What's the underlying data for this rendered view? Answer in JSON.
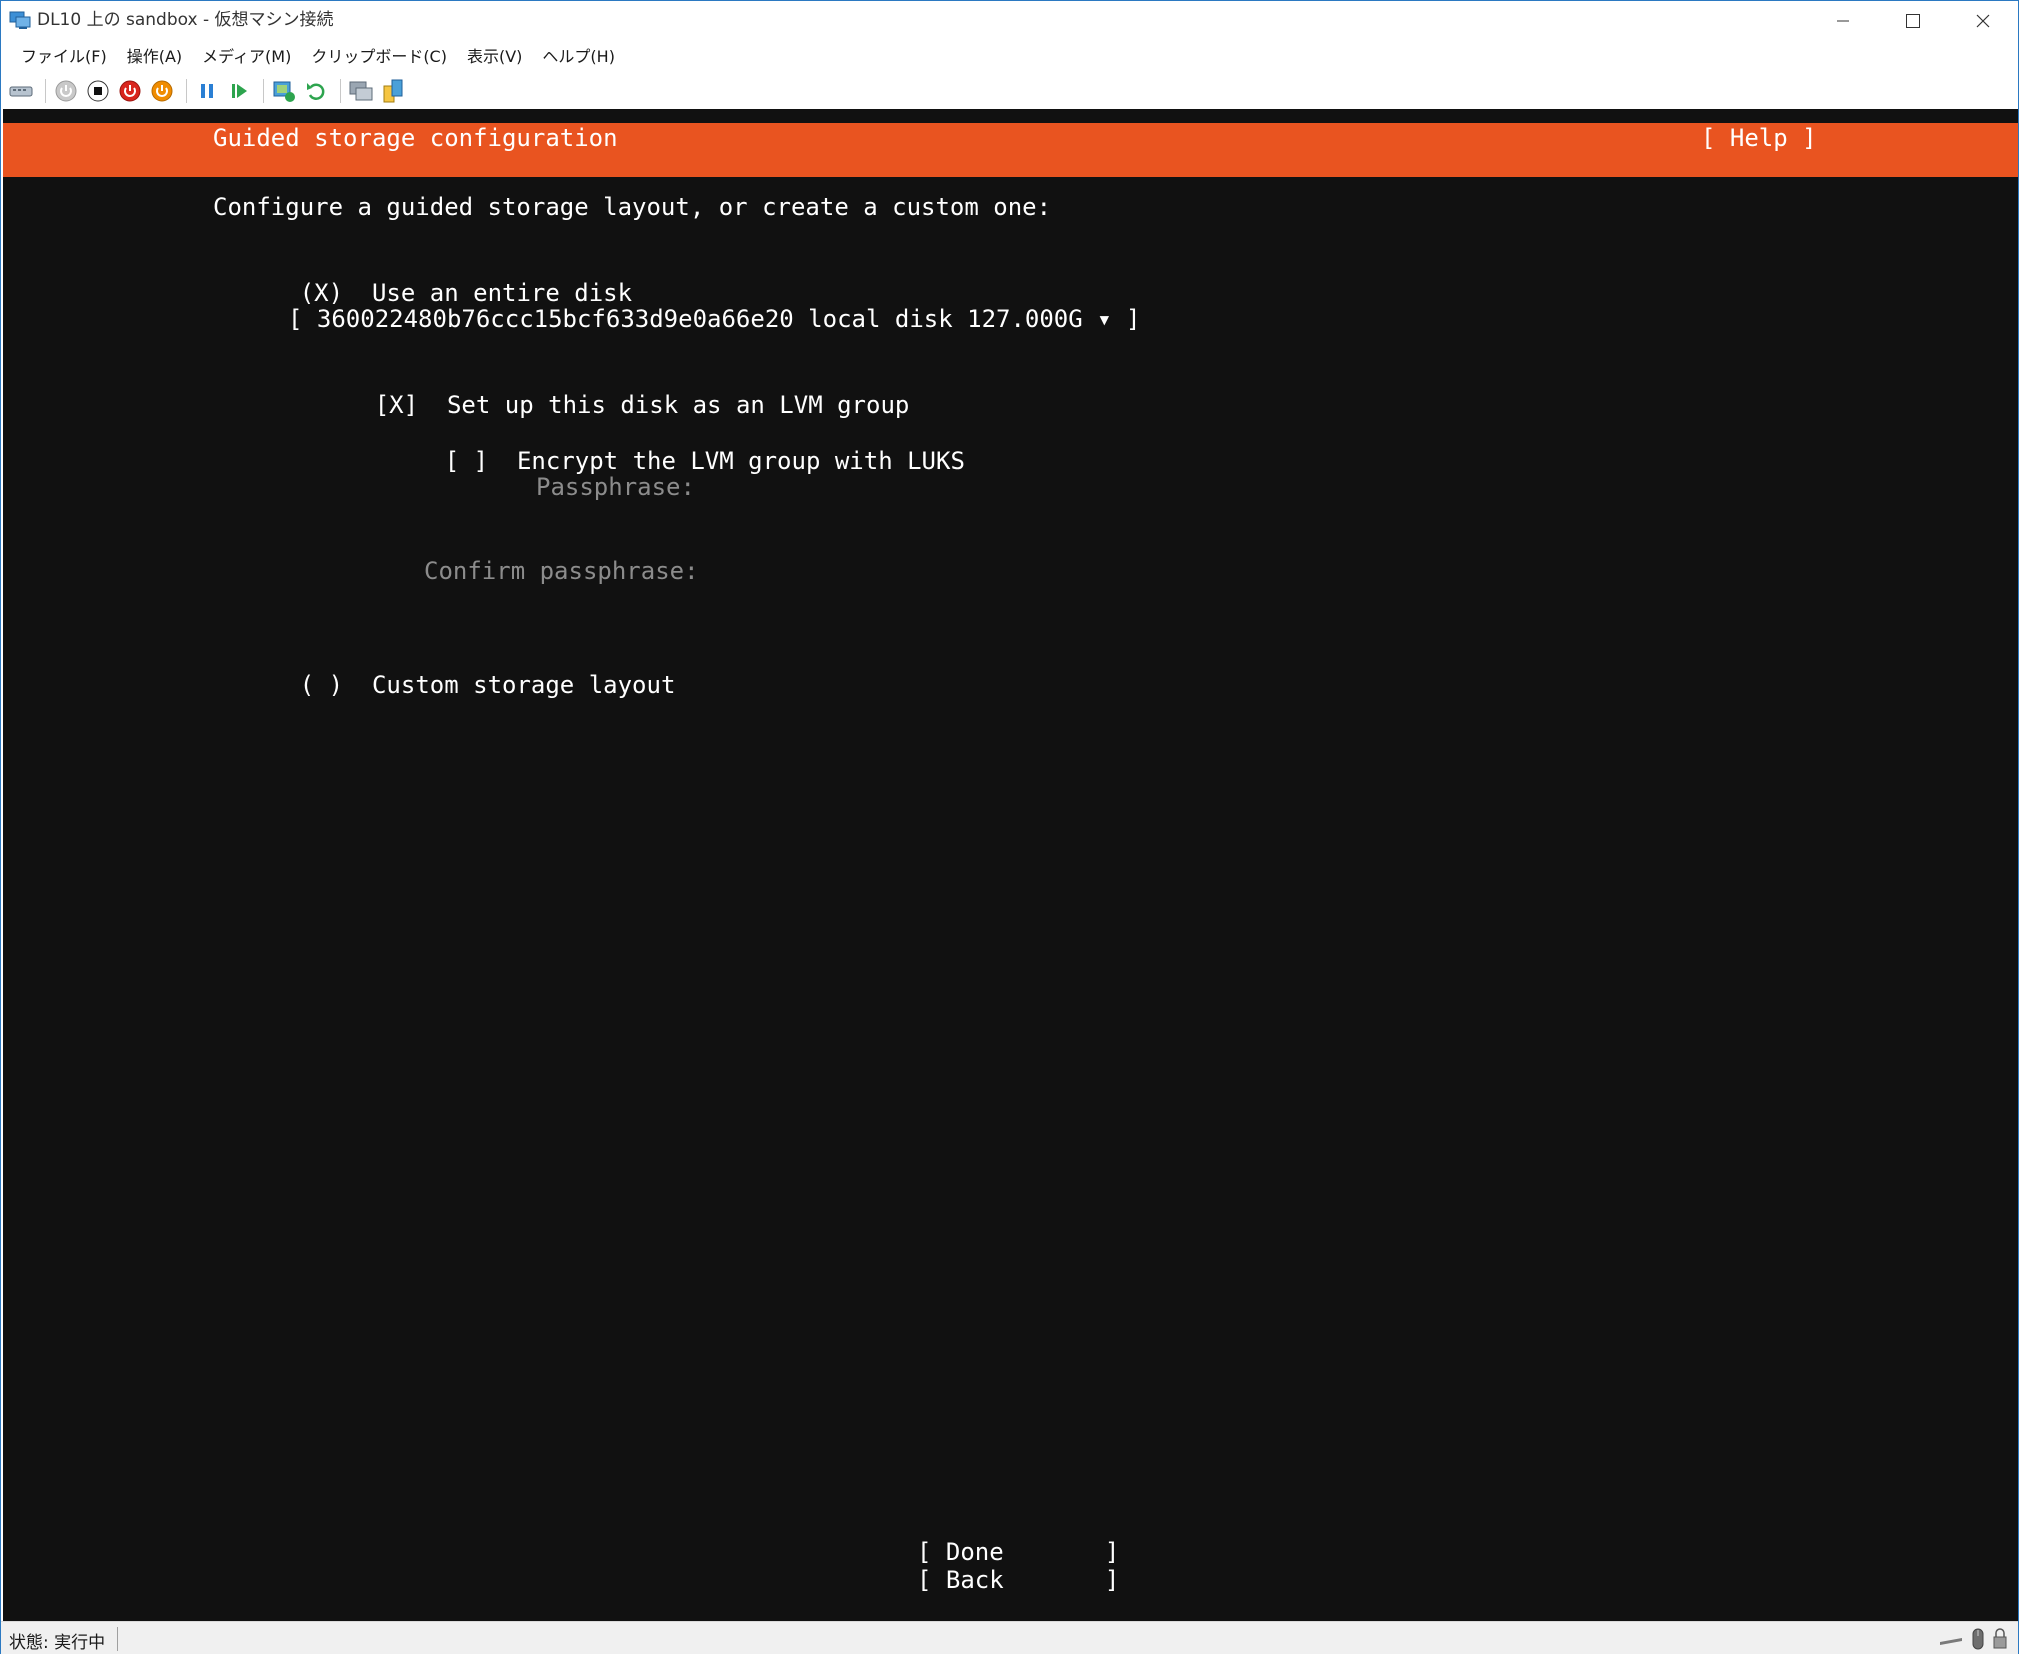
{
  "window": {
    "title": "DL10 上の sandbox - 仮想マシン接続",
    "minimize_icon": "minimize-icon",
    "maximize_icon": "maximize-icon",
    "close_icon": "close-icon"
  },
  "menu": {
    "items": [
      "ファイル(F)",
      "操作(A)",
      "メディア(M)",
      "クリップボード(C)",
      "表示(V)",
      "ヘルプ(H)"
    ]
  },
  "toolbar": {
    "icons": [
      "ctrl-alt-del-icon",
      "start-icon",
      "turn-off-icon",
      "shut-down-icon",
      "save-icon",
      "pause-icon",
      "resume-icon",
      "checkpoint-icon",
      "revert-icon",
      "enhanced-session-icon",
      "share-icon"
    ]
  },
  "installer": {
    "header_title": "Guided storage configuration",
    "help_label": "[ Help ]",
    "prompt": "Configure a guided storage layout, or create a custom one:",
    "use_entire_disk": {
      "marker": "(X)",
      "label": "Use an entire disk"
    },
    "disk_select": "[ 360022480b76ccc15bcf633d9e0a66e20 local disk 127.000G ▾ ]",
    "lvm": {
      "marker": "[X]",
      "label": "Set up this disk as an LVM group"
    },
    "luks": {
      "marker": "[ ]",
      "label": "Encrypt the LVM group with LUKS"
    },
    "passphrase_label": "Passphrase:",
    "confirm_passphrase_label": "Confirm passphrase:",
    "custom_layout": {
      "marker": "( )",
      "label": "Custom storage layout"
    },
    "done_button": "[ Done       ]",
    "back_button": "[ Back       ]",
    "accent_color": "#e95420",
    "background_color": "#111111"
  },
  "status": {
    "text": "状態: 実行中"
  }
}
